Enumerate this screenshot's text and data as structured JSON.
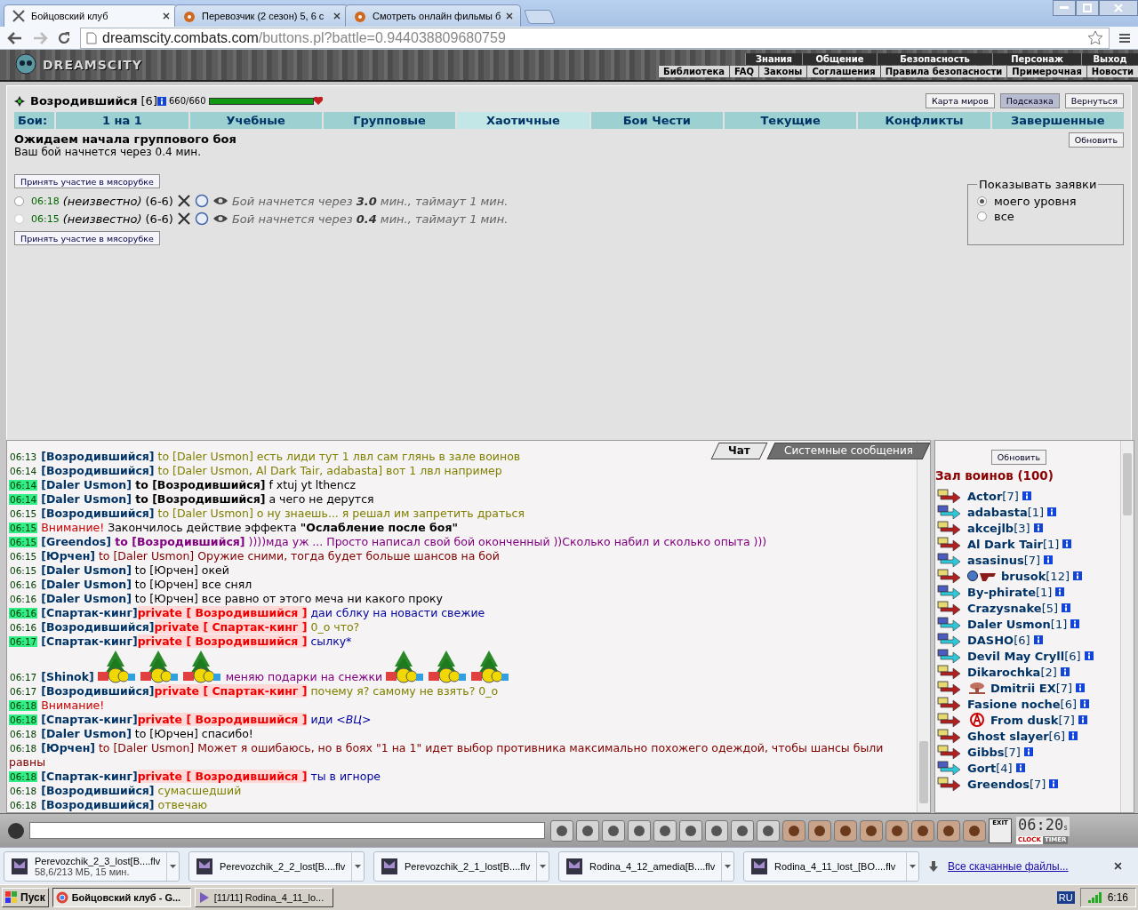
{
  "browser": {
    "tabs": [
      {
        "title": "Бойцовский клуб",
        "selected": true
      },
      {
        "title": "Перевозчик (2 сезон) 5, 6 с",
        "selected": false
      },
      {
        "title": "Смотреть онлайн фильмы б",
        "selected": false
      }
    ],
    "url": {
      "host": "dreamscity.combats.com",
      "path": "/buttons.pl?battle=0.944038809680759"
    }
  },
  "game_header": {
    "logo": "DREAMSCITY",
    "menu": [
      "Знания",
      "Общение",
      "Безопасность",
      "Персонаж",
      "Выход"
    ],
    "submenu": [
      "Библиотека",
      "FAQ",
      "Законы",
      "Соглашения",
      "Правила безопасности",
      "Примерочная",
      "Новости"
    ]
  },
  "player": {
    "name": "Возродившийся",
    "level": "[6]",
    "hp": "660/660",
    "hp_bar": {
      "level": 1.0
    }
  },
  "top_buttons": [
    {
      "label": "Карта миров",
      "selected": false
    },
    {
      "label": "Подсказка",
      "selected": true
    },
    {
      "label": "Вернуться",
      "selected": false
    }
  ],
  "battle_tabs": {
    "label": "Бои:",
    "tabs": [
      {
        "label": "1 на 1",
        "selected": false
      },
      {
        "label": "Учебные",
        "selected": false
      },
      {
        "label": "Групповые",
        "selected": false
      },
      {
        "label": "Хаотичные",
        "selected": true
      },
      {
        "label": "Бои Чести",
        "selected": false
      },
      {
        "label": "Текущие",
        "selected": false
      },
      {
        "label": "Конфликты",
        "selected": false
      },
      {
        "label": "Завершенные",
        "selected": false
      }
    ]
  },
  "status": {
    "title": "Ожидаем начала группового боя",
    "subtitle": "Ваш бой начнется через 0.4 мин.",
    "refresh": "Обновить"
  },
  "join_buttons": [
    "Принять участие в мясорубке",
    "Принять участие в мясорубке"
  ],
  "bids": [
    {
      "selected": false,
      "disabled": false,
      "time": "06:18",
      "who": "(неизвестно)",
      "range": "(6-6)",
      "info": "Бой начнется через **3.0** мин., таймаут 1 мин."
    },
    {
      "selected": false,
      "disabled": true,
      "time": "06:15",
      "who": "(неизвестно)",
      "range": "(6-6)",
      "info": "Бой начнется через **0.4** мин., таймаут 1 мин."
    }
  ],
  "filter": {
    "legend": "Показывать заявки",
    "options": [
      {
        "label": "моего уровня",
        "selected": true
      },
      {
        "label": "все",
        "selected": false
      }
    ]
  },
  "chat_tabs": [
    {
      "label": "Чат",
      "selected": true
    },
    {
      "label": "Системные сообщения",
      "selected": false
    }
  ],
  "chat": [
    {
      "time": "06:13",
      "highlight": false,
      "color": "#808000",
      "parts": [
        {
          "kind": "sender",
          "text": "[Возродившийся]"
        },
        {
          "kind": "text",
          "text": " to [Daler Usmon] есть лиди тут 1 лвл сам глянь в зале воинов"
        }
      ]
    },
    {
      "time": "06:14",
      "highlight": false,
      "color": "#808000",
      "parts": [
        {
          "kind": "sender",
          "text": "[Возродившийся]"
        },
        {
          "kind": "text",
          "text": " to [Daler Usmon, Al Dark Tair, adabasta] вот 1 лвл например"
        }
      ]
    },
    {
      "time": "06:14",
      "highlight": true,
      "color": "#000000",
      "parts": [
        {
          "kind": "sender",
          "text": "[Daler Usmon]"
        },
        {
          "kind": "bold",
          "text": " to [Возродившийся]"
        },
        {
          "kind": "text",
          "text": " f xtuj yt lthencz"
        }
      ]
    },
    {
      "time": "06:14",
      "highlight": true,
      "color": "#000000",
      "parts": [
        {
          "kind": "sender",
          "text": "[Daler Usmon]"
        },
        {
          "kind": "bold",
          "text": " to [Возродившийся]"
        },
        {
          "kind": "text",
          "text": " а чего не дерутся"
        }
      ]
    },
    {
      "time": "06:15",
      "highlight": false,
      "color": "#808000",
      "parts": [
        {
          "kind": "sender",
          "text": "[Возродившийся]"
        },
        {
          "kind": "text",
          "text": " to [Daler Usmon] о ну знаешь... я решал им запретить драться"
        }
      ]
    },
    {
      "time": "06:15",
      "highlight": true,
      "color": "#000000",
      "parts": [
        {
          "kind": "alert",
          "text": "Внимание!"
        },
        {
          "kind": "text",
          "text": " Закончилось действие эффекта "
        },
        {
          "kind": "bold",
          "text": "\"Ослабление после боя\""
        }
      ]
    },
    {
      "time": "06:15",
      "highlight": true,
      "color": "#800080",
      "parts": [
        {
          "kind": "sender",
          "text": "[Greendos]"
        },
        {
          "kind": "bold",
          "text": " to [Возродившийся]"
        },
        {
          "kind": "text",
          "text": " ))))мда уж ... Просто написал свой бой оконченный ))Сколько набил и сколько опыта )))"
        }
      ]
    },
    {
      "time": "06:15",
      "highlight": false,
      "color": "#800000",
      "parts": [
        {
          "kind": "sender",
          "text": "[Юрчен]"
        },
        {
          "kind": "text",
          "text": " to [Daler Usmon] Оружие сними, тогда будет больше шансов на бой"
        }
      ]
    },
    {
      "time": "06:15",
      "highlight": false,
      "color": "#000000",
      "parts": [
        {
          "kind": "sender",
          "text": "[Daler Usmon]"
        },
        {
          "kind": "text",
          "text": " to [Юрчен] окей"
        }
      ]
    },
    {
      "time": "06:16",
      "highlight": false,
      "color": "#000000",
      "parts": [
        {
          "kind": "sender",
          "text": "[Daler Usmon]"
        },
        {
          "kind": "text",
          "text": " to [Юрчен] все снял"
        }
      ]
    },
    {
      "time": "06:16",
      "highlight": false,
      "color": "#000000",
      "parts": [
        {
          "kind": "sender",
          "text": "[Daler Usmon]"
        },
        {
          "kind": "text",
          "text": " to [Юрчен] все равно от этого меча ни какого проку"
        }
      ]
    },
    {
      "time": "06:16",
      "highlight": true,
      "color": "#0000a0",
      "parts": [
        {
          "kind": "sender",
          "text": "[Спартак-кинг]"
        },
        {
          "kind": "private",
          "text": "private [ Возродившийся ]"
        },
        {
          "kind": "text",
          "text": " даи сблку на новасти свежие"
        }
      ]
    },
    {
      "time": "06:16",
      "highlight": false,
      "color": "#808000",
      "parts": [
        {
          "kind": "sender",
          "text": "[Возродившийся]"
        },
        {
          "kind": "private",
          "text": "private [ Спартак-кинг ]"
        },
        {
          "kind": "text",
          "text": " 0_о что?"
        }
      ]
    },
    {
      "time": "06:17",
      "highlight": true,
      "color": "#0000a0",
      "parts": [
        {
          "kind": "sender",
          "text": "[Спартак-кинг]"
        },
        {
          "kind": "private",
          "text": "private [ Возродившийся ]"
        },
        {
          "kind": "text",
          "text": " сылку*"
        }
      ]
    },
    {
      "time": "06:17",
      "highlight": false,
      "color": "#800080",
      "parts": [
        {
          "kind": "sender",
          "text": "[Shinok]"
        },
        {
          "kind": "gift"
        },
        {
          "kind": "gift"
        },
        {
          "kind": "gift"
        },
        {
          "kind": "text",
          "text": " меняю подарки на снежки"
        },
        {
          "kind": "gift"
        },
        {
          "kind": "gift"
        },
        {
          "kind": "gift"
        }
      ]
    },
    {
      "time": "06:17",
      "highlight": false,
      "color": "#808000",
      "parts": [
        {
          "kind": "sender",
          "text": "[Возродившийся]"
        },
        {
          "kind": "private",
          "text": "private [ Спартак-кинг ]"
        },
        {
          "kind": "text",
          "text": " почему я? самому не взять? 0_о"
        }
      ]
    },
    {
      "time": "06:18",
      "highlight": true,
      "color": "#cc0000",
      "parts": [
        {
          "kind": "alert",
          "text": "Внимание!"
        }
      ]
    },
    {
      "time": "06:18",
      "highlight": true,
      "color": "#0000a0",
      "parts": [
        {
          "kind": "sender",
          "text": "[Спартак-кинг]"
        },
        {
          "kind": "private",
          "text": "private [ Возродившийся ]"
        },
        {
          "kind": "text",
          "text": " иди "
        },
        {
          "kind": "italic",
          "text": "<ВЦ>"
        }
      ]
    },
    {
      "time": "06:18",
      "highlight": false,
      "color": "#000000",
      "parts": [
        {
          "kind": "sender",
          "text": "[Daler Usmon]"
        },
        {
          "kind": "text",
          "text": " to [Юрчен] спасибо!"
        }
      ]
    },
    {
      "time": "06:18",
      "highlight": false,
      "color": "#800000",
      "parts": [
        {
          "kind": "sender",
          "text": "[Юрчен]"
        },
        {
          "kind": "text",
          "text": " to [Daler Usmon] Может я ошибаюсь, но в боях \"1 на 1\" идет выбор противника максимально похожего одеждой, чтобы шансы были равны"
        }
      ]
    },
    {
      "time": "06:18",
      "highlight": true,
      "color": "#0000a0",
      "parts": [
        {
          "kind": "sender",
          "text": "[Спартак-кинг]"
        },
        {
          "kind": "private",
          "text": "private [ Возродившийся ]"
        },
        {
          "kind": "text",
          "text": " ты в игноре"
        }
      ]
    },
    {
      "time": "06:18",
      "highlight": false,
      "color": "#808000",
      "parts": [
        {
          "kind": "sender",
          "text": "[Возродившийся]"
        },
        {
          "kind": "text",
          "text": " сумасшедший"
        }
      ]
    },
    {
      "time": "06:18",
      "highlight": false,
      "color": "#808000",
      "parts": [
        {
          "kind": "sender",
          "text": "[Возродившийся]"
        },
        {
          "kind": "text",
          "text": " отвечаю"
        }
      ]
    }
  ],
  "players_panel": {
    "refresh": "Обновить",
    "title": "Зал воинов (100)",
    "players": [
      {
        "name": "Actor",
        "level": "[7]",
        "kind": "warm"
      },
      {
        "name": "adabasta",
        "level": "[1]",
        "kind": "cool"
      },
      {
        "name": "akcejlb",
        "level": "[3]",
        "kind": "warm"
      },
      {
        "name": "Al Dark Tair",
        "level": "[1]",
        "kind": "warm"
      },
      {
        "name": "asasinus",
        "level": "[7]",
        "kind": "cool"
      },
      {
        "name": "brusok",
        "level": "[12]",
        "kind": "warm",
        "badge": true
      },
      {
        "name": "By-phirate",
        "level": "[1]",
        "kind": "cool"
      },
      {
        "name": "Crazysnake",
        "level": "[5]",
        "kind": "warm"
      },
      {
        "name": "Daler Usmon",
        "level": "[1]",
        "kind": "cool"
      },
      {
        "name": "DASHO",
        "level": "[6]",
        "kind": "cool"
      },
      {
        "name": "Devil May Cryll",
        "level": "[6]",
        "kind": "cool"
      },
      {
        "name": "Dikarochka",
        "level": "[2]",
        "kind": "warm"
      },
      {
        "name": "Dmitrii EX",
        "level": "[7]",
        "kind": "warm",
        "badge": true
      },
      {
        "name": "Fasione noche",
        "level": "[6]",
        "kind": "warm"
      },
      {
        "name": "From dusk",
        "level": "[7]",
        "kind": "warm",
        "badge": true
      },
      {
        "name": "Ghost slayer",
        "level": "[6]",
        "kind": "warm"
      },
      {
        "name": "Gibbs",
        "level": "[7]",
        "kind": "warm"
      },
      {
        "name": "Gort",
        "level": "[4]",
        "kind": "cool"
      },
      {
        "name": "Greendos",
        "level": "[7]",
        "kind": "warm"
      }
    ]
  },
  "toolbar": {
    "exit": "EXIT",
    "clock": "06:20",
    "clock_suffix": "s",
    "clock_tabs": [
      {
        "label": "CLOCK",
        "selected": true
      },
      {
        "label": "TIMER",
        "selected": false
      }
    ]
  },
  "downloads": {
    "items": [
      {
        "name": "Perevozchik_2_3_lost[B....flv",
        "detail": "58,6/213 МБ, 15 мин."
      },
      {
        "name": "Perevozchik_2_2_lost[B....flv"
      },
      {
        "name": "Perevozchik_2_1_lost[B....flv"
      },
      {
        "name": "Rodina_4_12_amedia[B....flv"
      },
      {
        "name": "Rodina_4_11_lost_[BO....flv"
      }
    ],
    "all": "Все скачанные файлы..."
  },
  "taskbar": {
    "start": "Пуск",
    "tasks": [
      {
        "title": "Бойцовский клуб - G...",
        "selected": true
      },
      {
        "title": "[11/11] Rodina_4_11_lo...",
        "selected": false
      }
    ],
    "lang": "RU",
    "time": "6:16"
  }
}
